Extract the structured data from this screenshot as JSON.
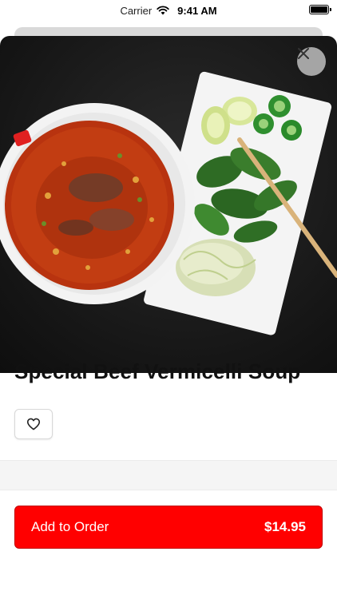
{
  "status_bar": {
    "carrier": "Carrier",
    "time": "9:41 AM",
    "wifi_icon": "wifi-icon",
    "battery_icon": "battery-icon"
  },
  "item": {
    "name": "Special Beef Vermicelli Soup",
    "image_icon": "food-photo"
  },
  "actions": {
    "close_icon": "close-icon",
    "favorite_icon": "heart-icon",
    "add_to_order_label": "Add to Order",
    "price": "$14.95"
  },
  "colors": {
    "accent": "#ff0000",
    "hero_background": "#161616",
    "close_button_bg": "#bebebe"
  }
}
